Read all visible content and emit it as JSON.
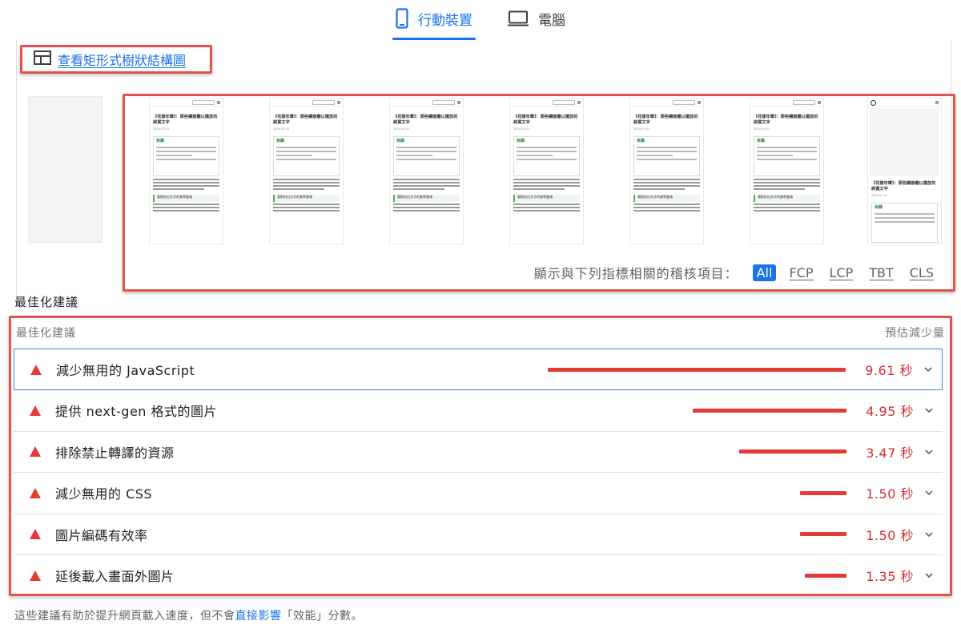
{
  "tabs": [
    {
      "label": "行動裝置",
      "icon": "mobile-phone-icon",
      "active": true
    },
    {
      "label": "電腦",
      "icon": "desktop-monitor-icon",
      "active": false
    }
  ],
  "treemap": {
    "label": "查看矩形式樹狀結構圖",
    "icon": "treemap-icon"
  },
  "filmstrip": {
    "frame_title": "《花樣年華》：那些鑲嵌雕以擺放的寂寞文字",
    "frame_date": "2019-02-01",
    "toc_heading": "目錄",
    "section_label": "電影拍出文字的美學靈魂",
    "last_frame_title": "《花樣年華》：那些鑲嵌雕以擺放的寂寞文字"
  },
  "metrics_filter": {
    "label": "顯示與下列指標相關的稽核項目：",
    "options": [
      "All",
      "FCP",
      "LCP",
      "TBT",
      "CLS"
    ],
    "active": "All"
  },
  "section_heading": "最佳化建議",
  "opportunities": {
    "header_left": "最佳化建議",
    "header_right": "預估減少量",
    "items": [
      {
        "title": "減少無用的 JavaScript",
        "savings": 9.61,
        "value": "9.61 秒"
      },
      {
        "title": "提供 next-gen 格式的圖片",
        "savings": 4.95,
        "value": "4.95 秒"
      },
      {
        "title": "排除禁止轉譯的資源",
        "savings": 3.47,
        "value": "3.47 秒"
      },
      {
        "title": "減少無用的 CSS",
        "savings": 1.5,
        "value": "1.50 秒"
      },
      {
        "title": "圖片編碼有效率",
        "savings": 1.5,
        "value": "1.50 秒"
      },
      {
        "title": "延後載入畫面外圖片",
        "savings": 1.35,
        "value": "1.35 秒"
      }
    ]
  },
  "footnote": {
    "before": "這些建議有助於提升網頁載入速度，但不會",
    "link": "直接影響",
    "after": "「效能」分數。"
  },
  "colors": {
    "accent": "#1a73e8",
    "fail": "#e53935",
    "highlight": "#e2534d"
  }
}
